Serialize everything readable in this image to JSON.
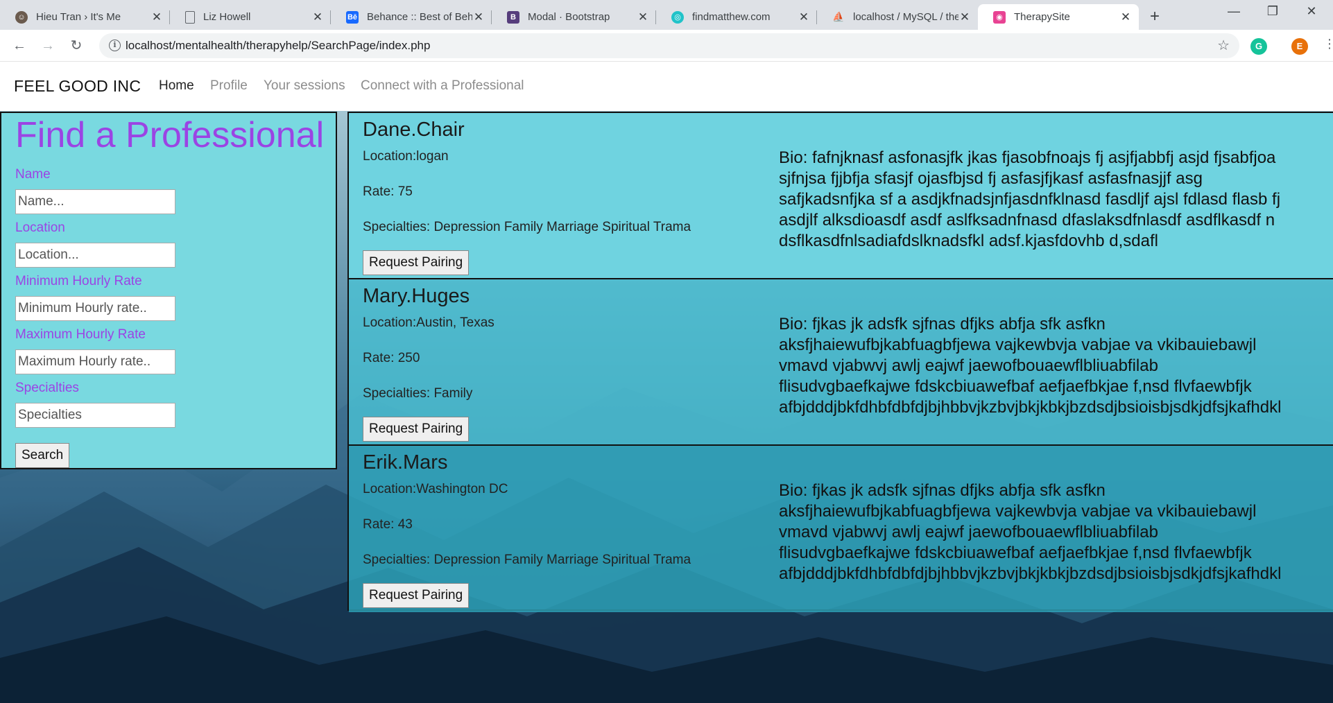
{
  "browser": {
    "tabs": [
      {
        "title": "Hieu Tran › It's Me",
        "icon": "avatar-icon"
      },
      {
        "title": "Liz Howell",
        "icon": "document-icon"
      },
      {
        "title": "Behance :: Best of Beh",
        "icon": "behance-icon"
      },
      {
        "title": "Modal · Bootstrap",
        "icon": "bootstrap-icon"
      },
      {
        "title": "findmatthew.com",
        "icon": "globe-icon"
      },
      {
        "title": "localhost / MySQL / the",
        "icon": "phpmyadmin-icon"
      },
      {
        "title": "TherapySite",
        "icon": "therapysite-icon",
        "active": true
      }
    ],
    "url": "localhost/mentalhealth/therapyhelp/SearchPage/index.php",
    "profile_initial": "E",
    "colors": {
      "tabstrip": "#dee1e6",
      "profile": "#e8710a",
      "extension": "#15c39a"
    }
  },
  "site": {
    "brand": "FEEL GOOD INC",
    "nav": [
      {
        "label": "Home",
        "active": true
      },
      {
        "label": "Profile"
      },
      {
        "label": "Your sessions"
      },
      {
        "label": "Connect with a Professional"
      }
    ]
  },
  "search": {
    "title": "Find a Professional",
    "fields": [
      {
        "label": "Name",
        "placeholder": "Name...",
        "value": ""
      },
      {
        "label": "Location",
        "placeholder": "Location...",
        "value": ""
      },
      {
        "label": "Minimum Hourly Rate",
        "placeholder": "Minimum Hourly rate..",
        "value": ""
      },
      {
        "label": "Maximum Hourly Rate",
        "placeholder": "Maximum Hourly rate..",
        "value": ""
      },
      {
        "label": "Specialties",
        "placeholder": "Specialties",
        "value": ""
      }
    ],
    "button": "Search",
    "colors": {
      "panel": "#79d9e0",
      "accent": "#9b44e4"
    }
  },
  "results": [
    {
      "name": "Dane.Chair",
      "location": "Location:logan",
      "rate": "Rate: 75",
      "specialties": "Specialties: Depression Family Marriage Spiritual Trama",
      "bio_lines": [
        "Bio: fafnjknasf asfonasjfk jkas fjasobfnoajs fj asjfjabbfj asjd fjsabfjoa",
        "sjfnjsa fjjbfja sfasjf ojasfbjsd fj asfasjfjkasf asfasfnasjjf asg",
        "safjkadsnfjka sf a asdjkfnadsjnfjasdnfklnasd fasdljf ajsl fdlasd flasb fj",
        "asdjlf alksdioasdf asdf aslfksadnfnasd dfaslaksdfnlasdf asdflkasdf n",
        "dsflkasdfnlsadiafdslknadsfkl adsf.kjasfdovhb d,sdafl"
      ],
      "button": "Request Pairing"
    },
    {
      "name": "Mary.Huges",
      "location": "Location:Austin, Texas",
      "rate": "Rate: 250",
      "specialties": "Specialties: Family",
      "bio_lines": [
        "Bio: fjkas jk adsfk sjfnas dfjks abfja sfk asfkn",
        "aksfjhaiewufbjkabfuagbfjewa vajkewbvja vabjae va vkibauiebawjl",
        "vmavd vjabwvj awlj eajwf jaewofbouaewflbliuabfilab",
        "flisudvgbaefkajwe fdskcbiuawefbaf aefjaefbkjae f,nsd flvfaewbfjk",
        "afbjdddjbkfdhbfdbfdjbjhbbvjkzbvjbkjkbkjbzdsdjbsioisbjsdkjdfsjkafhdkl"
      ],
      "button": "Request Pairing"
    },
    {
      "name": "Erik.Mars",
      "location": "Location:Washington DC",
      "rate": "Rate: 43",
      "specialties": "Specialties: Depression Family Marriage Spiritual Trama",
      "bio_lines": [
        "Bio: fjkas jk adsfk sjfnas dfjks abfja sfk asfkn",
        "aksfjhaiewufbjkabfuagbfjewa vajkewbvja vabjae va vkibauiebawjl",
        "vmavd vjabwvj awlj eajwf jaewofbouaewflbliuabfilab",
        "flisudvgbaefkajwe fdskcbiuawefbaf aefjaefbkjae f,nsd flvfaewbfjk",
        "afbjdddjbkfdhbfdbfdjbjhbbvjkzbvjbkjkbkjbzdsdjbsioisbjsdkjdfsjkafhdkl"
      ],
      "button": "Request Pairing"
    }
  ]
}
